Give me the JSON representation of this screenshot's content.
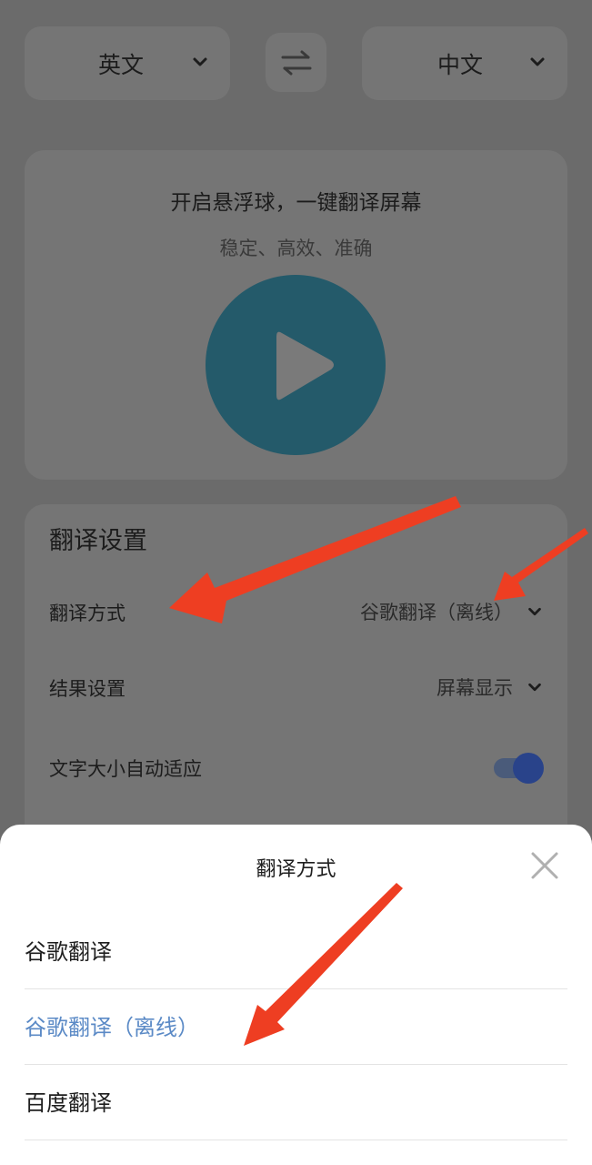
{
  "lang_bar": {
    "source_lang": "英文",
    "target_lang": "中文"
  },
  "hero": {
    "title": "开启悬浮球，一键翻译屏幕",
    "subtitle": "稳定、高效、准确"
  },
  "settings": {
    "title": "翻译设置",
    "rows": [
      {
        "label": "翻译方式",
        "value": "谷歌翻译（离线）"
      },
      {
        "label": "结果设置",
        "value": "屏幕显示"
      },
      {
        "label": "文字大小自动适应",
        "toggle_on": true
      }
    ]
  },
  "sheet": {
    "title": "翻译方式",
    "options": [
      {
        "label": "谷歌翻译",
        "selected": false
      },
      {
        "label": "谷歌翻译（离线）",
        "selected": true
      },
      {
        "label": "百度翻译",
        "selected": false
      }
    ]
  },
  "colors": {
    "dim_background": "#6b6b6b",
    "card": "#757575",
    "play_button": "#245a6a",
    "toggle_knob": "#29438a",
    "selected_option": "#5b8ac6",
    "annotation_arrow": "#ee3e22"
  }
}
